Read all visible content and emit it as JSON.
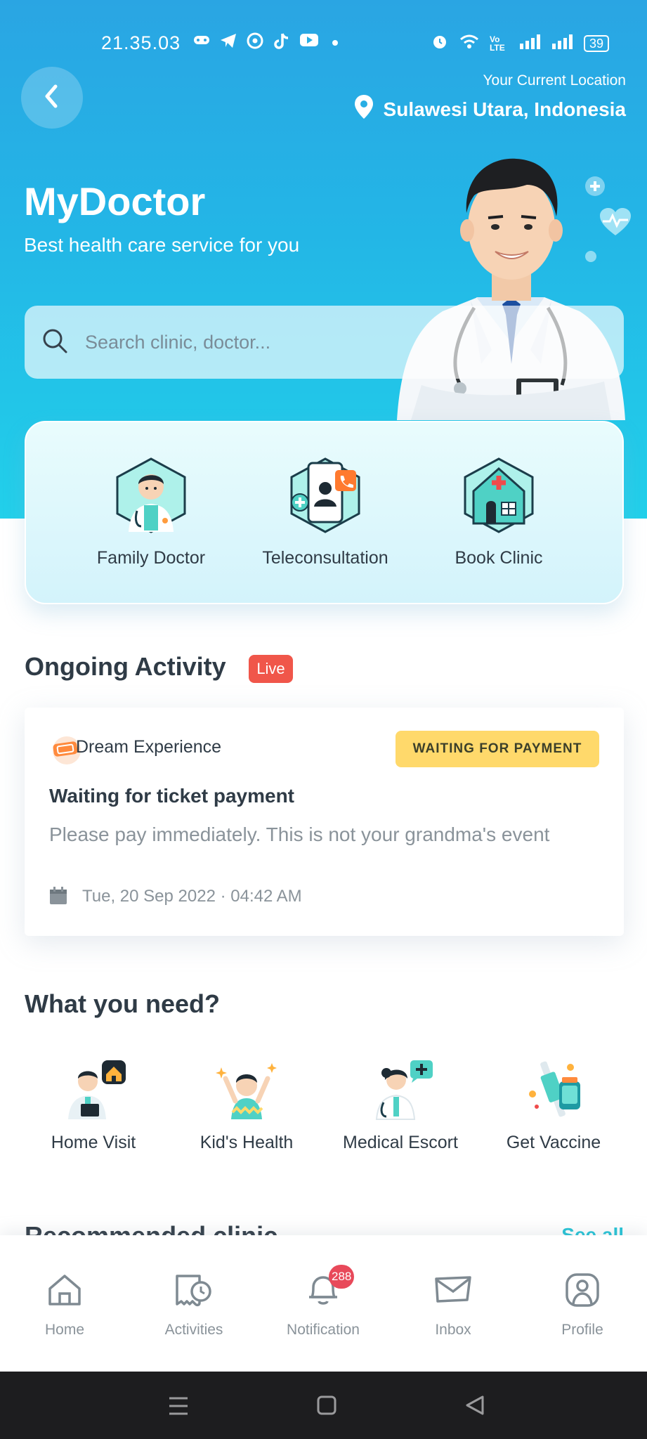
{
  "status_bar": {
    "time": "21.35.03",
    "battery": "39",
    "signal_text": "Vo LTE"
  },
  "header": {
    "location_caption": "Your Current Location",
    "location_value": "Sulawesi Utara, Indonesia",
    "app_title": "MyDoctor",
    "app_subtitle": "Best health care service for you"
  },
  "search": {
    "placeholder": "Search clinic, doctor..."
  },
  "services": [
    {
      "label": "Family Doctor",
      "icon": "family-doctor-icon"
    },
    {
      "label": "Teleconsultation",
      "icon": "teleconsultation-icon"
    },
    {
      "label": "Book Clinic",
      "icon": "book-clinic-icon"
    }
  ],
  "ongoing": {
    "title": "Ongoing Activity",
    "badge": "Live",
    "card": {
      "merchant": "Dream Experience",
      "status": "WAITING FOR PAYMENT",
      "title": "Waiting for ticket payment",
      "description": "Please pay immediately. This is not your grandma's event",
      "date": "Tue, 20 Sep 2022 · 04:42 AM"
    }
  },
  "needs": {
    "title": "What you need?",
    "items": [
      {
        "label": "Home Visit"
      },
      {
        "label": "Kid's Health"
      },
      {
        "label": "Medical Escort"
      },
      {
        "label": "Get Vaccine"
      }
    ]
  },
  "recommended": {
    "title": "Recommended clinic",
    "see_all": "See all"
  },
  "bottom_nav": {
    "items": [
      {
        "label": "Home",
        "icon": "home-icon"
      },
      {
        "label": "Activities",
        "icon": "activities-icon"
      },
      {
        "label": "Notification",
        "icon": "bell-icon",
        "badge": "288"
      },
      {
        "label": "Inbox",
        "icon": "inbox-icon"
      },
      {
        "label": "Profile",
        "icon": "profile-icon"
      }
    ]
  },
  "colors": {
    "hero_top": "#2aa5e3",
    "hero_bottom": "#22d0ea",
    "accent": "#22c3d6",
    "live": "#f0564a",
    "status_badge": "#ffd96b",
    "notification_badge": "#e8495a"
  }
}
